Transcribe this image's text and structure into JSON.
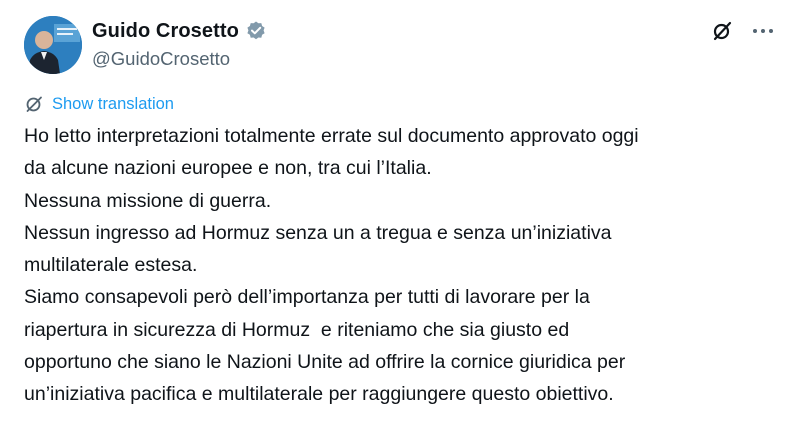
{
  "author": {
    "display_name": "Guido Crosetto",
    "handle": "@GuidoCrosetto",
    "verified_icon": "verified-badge-icon",
    "verified_color": "#829aab"
  },
  "actions": {
    "grok_icon": "grok-icon",
    "more_icon": "more-options-icon"
  },
  "translate": {
    "label": "Show translation",
    "icon": "translate-globe-icon",
    "color": "#1d9bf0"
  },
  "tweet": {
    "lines": [
      "Ho letto interpretazioni totalmente errate sul documento approvato oggi",
      "da alcune nazioni europee e non, tra cui l’Italia.",
      "Nessuna missione di guerra.",
      "Nessun ingresso ad Hormuz senza un a tregua e senza un’iniziativa",
      "multilaterale estesa.",
      "Siamo consapevoli però dell’importanza per tutti di lavorare per la",
      "riapertura in sicurezza di Hormuz  e riteniamo che sia giusto ed",
      "opportuno che siano le Nazioni Unite ad offrire la cornice giuridica per",
      "un’iniziativa pacifica e multilaterale per raggiungere questo obiettivo."
    ]
  }
}
